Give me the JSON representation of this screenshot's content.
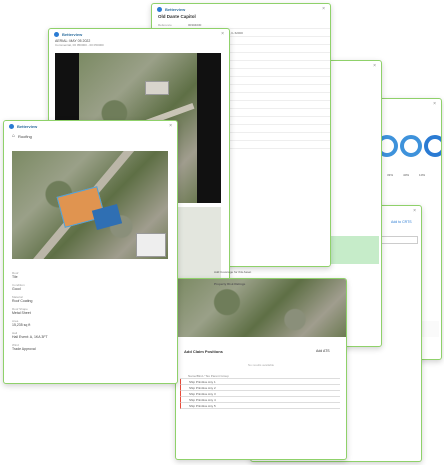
{
  "app": {
    "brand": "Betterview",
    "close_symbol": "×"
  },
  "win_details": {
    "title": "Old Dante Capitol",
    "rows": [
      {
        "label": "Reference",
        "value": "00304030"
      },
      {
        "label": "",
        "value": "Old Dante Rd, Honor, and Washington Ter, Springfield, IL 62000"
      },
      {
        "label": "",
        "value": "0000000037"
      },
      {
        "label": "",
        "value": "https://www.example.com/00304030"
      },
      {
        "label": "",
        "value": "A5-2"
      },
      {
        "label": "",
        "value": "100 S. Street St, Springfield, IL 62000"
      },
      {
        "label": "",
        "value": "Commercial Area"
      },
      {
        "label": "",
        "value": "0000000000"
      },
      {
        "label": "",
        "value": "Masonry"
      },
      {
        "label": "",
        "value": "Old Dante Rd, Springfield, IL 62000"
      },
      {
        "label": "",
        "value": "4000000 Field, Dante, Springfield"
      },
      {
        "label": "",
        "value": "0000000"
      },
      {
        "label": "",
        "value": "Masonry"
      },
      {
        "label": "",
        "value": "https://www.example.com/00304030"
      },
      {
        "label": "",
        "value": "0000000000"
      },
      {
        "label": "",
        "value": "1000 S. Street St, Springfield IL 62000"
      }
    ],
    "footer1": "Add Coverage for this Asset",
    "footer2": "Property Risk Ratings"
  },
  "win_aerial_top": {
    "date": "AERIAL: MAY 05 2022",
    "subtitle": "Commercial, 00 050000 - 00 050000"
  },
  "win_main": {
    "heading": "Roofing",
    "fields": [
      {
        "label": "Roof",
        "value": "Tile"
      },
      {
        "label": "Condition",
        "value": "Good"
      },
      {
        "label": "Material",
        "value": "Roof Coating"
      },
      {
        "label": "Roof Shape",
        "value": "Metal Sheet"
      },
      {
        "label": "Area",
        "value": "15,235 sq ft"
      },
      {
        "label": "Hail",
        "value": "Hail Event: A, 1KA 3FT"
      },
      {
        "label": "Wind",
        "value": "Trade Approval"
      }
    ]
  },
  "win_stats": {
    "donut_labels": [
      "22%",
      "33%",
      "40%",
      "10%"
    ],
    "link": "Add to CRTS",
    "level_label": "Hazard",
    "level": "Moderate"
  },
  "win_positions": {
    "title": "Add Claim Positions",
    "add_label": "Add ATS",
    "empty_text": "No results available",
    "column": "Name/Bind / Tax Parent Group",
    "rows": [
      "Ship Primitive Any 1",
      "Ship Primitive Any 2",
      "Ship Primitive Any 3",
      "Ship Primitive Any 4",
      "Ship Primitive Any 5"
    ]
  }
}
